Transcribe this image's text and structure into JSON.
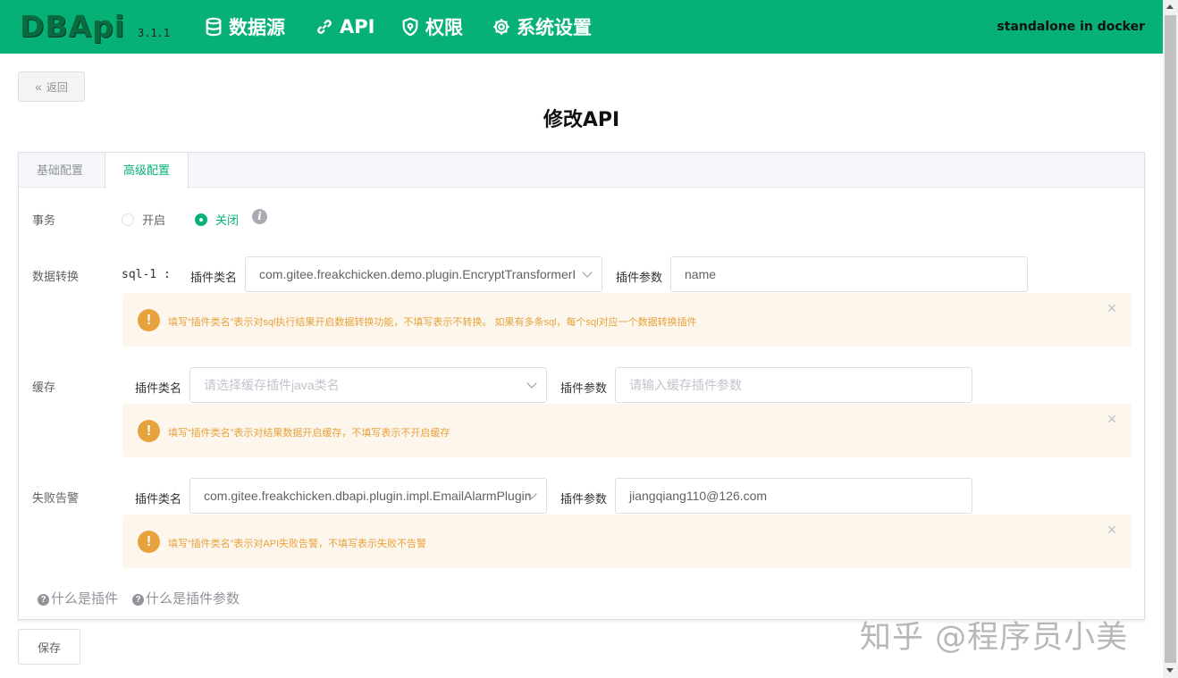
{
  "header": {
    "logo": "DBApi",
    "version": "3.1.1",
    "nav": [
      {
        "label": "数据源",
        "icon": "database-icon"
      },
      {
        "label": "API",
        "icon": "link-icon"
      },
      {
        "label": "权限",
        "icon": "shield-icon"
      },
      {
        "label": "系统设置",
        "icon": "gear-icon"
      }
    ],
    "deploy_mode": "standalone in docker"
  },
  "back_label": "返回",
  "page_title": "修改API",
  "tabs": [
    {
      "label": "基础配置",
      "active": false
    },
    {
      "label": "高级配置",
      "active": true
    }
  ],
  "transaction": {
    "label": "事务",
    "options": [
      "开启",
      "关闭"
    ],
    "selected": "关闭"
  },
  "transform": {
    "label": "数据转换",
    "sql_tag": "sql-1 :",
    "class_label": "插件类名",
    "class_value": "com.gitee.freakchicken.demo.plugin.EncryptTransformerI",
    "param_label": "插件参数",
    "param_value": "name",
    "alert": "填写“插件类名”表示对sql执行结果开启数据转换功能，不填写表示不转换。 如果有多条sql，每个sql对应一个数据转换插件"
  },
  "cache": {
    "label": "缓存",
    "class_label": "插件类名",
    "class_placeholder": "请选择缓存插件java类名",
    "param_label": "插件参数",
    "param_placeholder": "请输入缓存插件参数",
    "alert": "填写“插件类名”表示对结果数据开启缓存，不填写表示不开启缓存"
  },
  "alarm": {
    "label": "失败告警",
    "class_label": "插件类名",
    "class_value": "com.gitee.freakchicken.dbapi.plugin.impl.EmailAlarmPlugin",
    "param_label": "插件参数",
    "param_value": "jiangqiang110@126.com",
    "alert": "填写“插件类名”表示对API失败告警，不填写表示失败不告警"
  },
  "help_links": [
    "什么是插件",
    "什么是插件参数"
  ],
  "save_label": "保存",
  "watermark": "知乎 @程序员小美",
  "colors": {
    "primary": "#07b175",
    "warning": "#e6a23c",
    "warning_bg": "#fdf6ec"
  }
}
